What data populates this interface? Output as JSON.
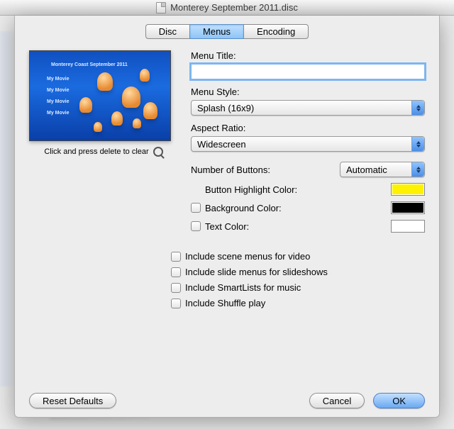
{
  "window": {
    "title": "Monterey September 2011.disc"
  },
  "tabs": {
    "items": [
      "Disc",
      "Menus",
      "Encoding"
    ],
    "active": 1
  },
  "preview": {
    "caption": "Click and press delete to clear",
    "overlay_title": "Monterey Coast   September 2011",
    "overlay_item": "My Movie"
  },
  "form": {
    "menu_title_label": "Menu Title:",
    "menu_title_value": "",
    "menu_style_label": "Menu Style:",
    "menu_style_value": "Splash (16x9)",
    "aspect_ratio_label": "Aspect Ratio:",
    "aspect_ratio_value": "Widescreen",
    "num_buttons_label": "Number of Buttons:",
    "num_buttons_value": "Automatic",
    "highlight_color_label": "Button Highlight Color:",
    "highlight_color": "#fff200",
    "background_color_label": "Background Color:",
    "background_color": "#000000",
    "text_color_label": "Text Color:",
    "text_color": "#ffffff"
  },
  "includes": {
    "scene_menus": "Include scene menus for video",
    "slide_menus": "Include slide menus for slideshows",
    "smartlists": "Include SmartLists for music",
    "shuffle": "Include Shuffle play"
  },
  "buttons": {
    "reset": "Reset Defaults",
    "cancel": "Cancel",
    "ok": "OK"
  }
}
